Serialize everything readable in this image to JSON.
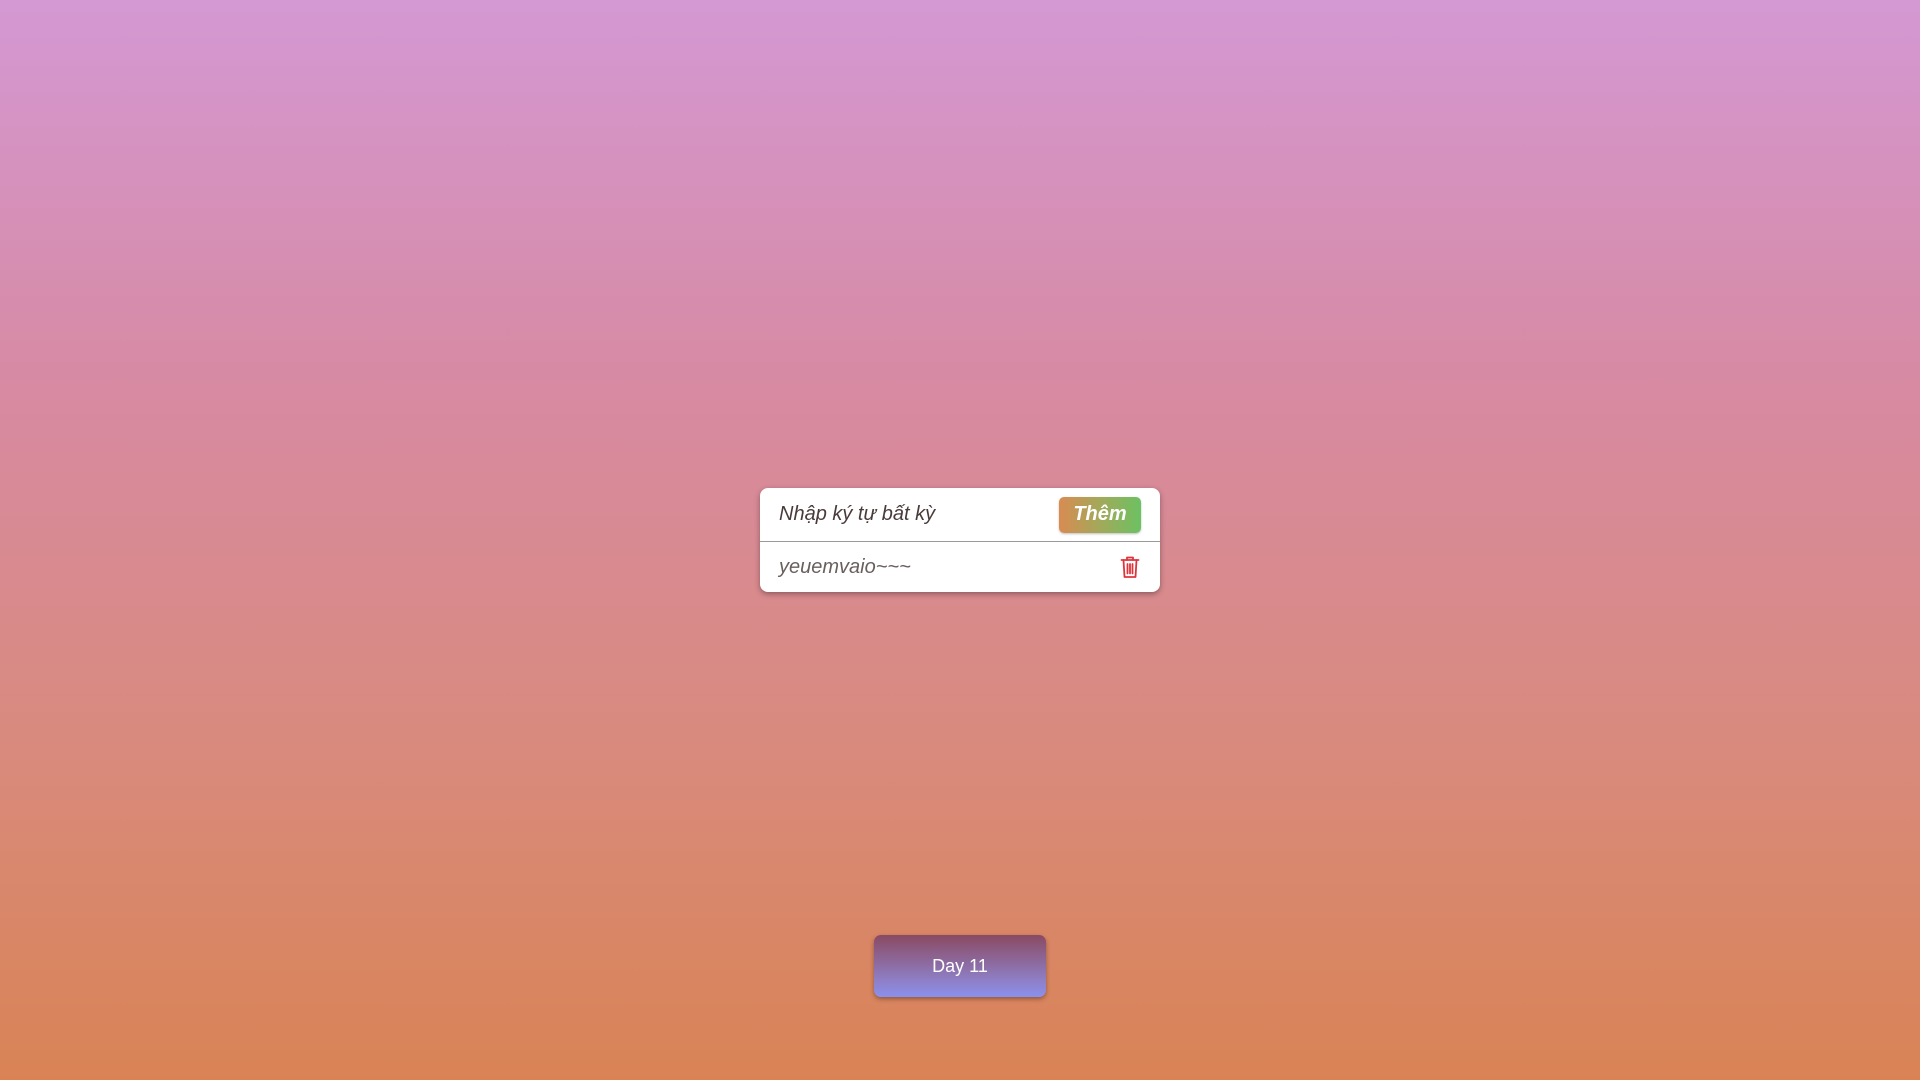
{
  "todo": {
    "input": {
      "placeholder": "Nhập ký tự bất kỳ",
      "value": ""
    },
    "add_button_label": "Thêm",
    "items": [
      {
        "text": "yeuemvaio~~~",
        "delete_icon": "trash-icon"
      }
    ]
  },
  "footer": {
    "day_button_label": "Day 11"
  },
  "colors": {
    "delete_icon": "#e0343c",
    "add_button_gradient": [
      "#d98b52",
      "#6cc162"
    ],
    "day_button_gradient": [
      "#8a4a62",
      "#8a90ee"
    ]
  }
}
